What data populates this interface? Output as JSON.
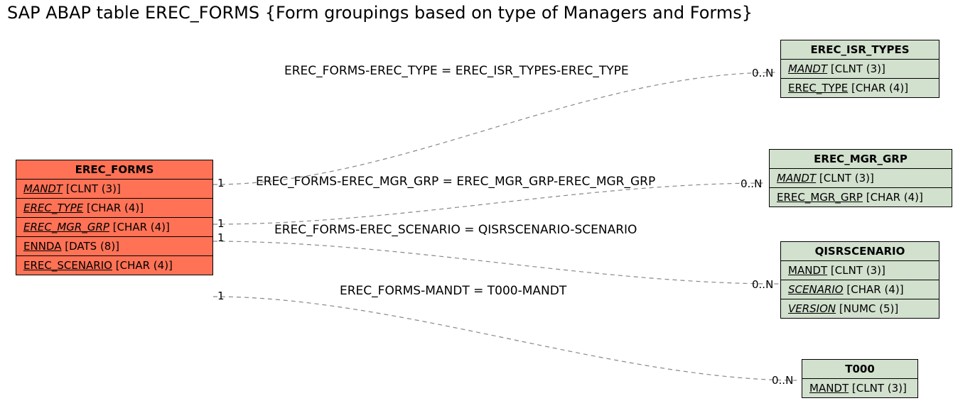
{
  "title": "SAP ABAP table EREC_FORMS {Form groupings based on type of Managers and Forms}",
  "main": {
    "name": "EREC_FORMS",
    "fields": [
      {
        "name": "MANDT",
        "type": "[CLNT (3)]",
        "style": "k"
      },
      {
        "name": "EREC_TYPE",
        "type": "[CHAR (4)]",
        "style": "k"
      },
      {
        "name": "EREC_MGR_GRP",
        "type": "[CHAR (4)]",
        "style": "k"
      },
      {
        "name": "ENNDA",
        "type": "[DATS (8)]",
        "style": "pk"
      },
      {
        "name": "EREC_SCENARIO",
        "type": "[CHAR (4)]",
        "style": "pk"
      }
    ]
  },
  "related": {
    "t1": {
      "name": "EREC_ISR_TYPES",
      "fields": [
        {
          "name": "MANDT",
          "type": "[CLNT (3)]",
          "style": "k"
        },
        {
          "name": "EREC_TYPE",
          "type": "[CHAR (4)]",
          "style": "pk"
        }
      ]
    },
    "t2": {
      "name": "EREC_MGR_GRP",
      "fields": [
        {
          "name": "MANDT",
          "type": "[CLNT (3)]",
          "style": "k"
        },
        {
          "name": "EREC_MGR_GRP",
          "type": "[CHAR (4)]",
          "style": "pk"
        }
      ]
    },
    "t3": {
      "name": "QISRSCENARIO",
      "fields": [
        {
          "name": "MANDT",
          "type": "[CLNT (3)]",
          "style": "pk"
        },
        {
          "name": "SCENARIO",
          "type": "[CHAR (4)]",
          "style": "k"
        },
        {
          "name": "VERSION",
          "type": "[NUMC (5)]",
          "style": "k"
        }
      ]
    },
    "t4": {
      "name": "T000",
      "fields": [
        {
          "name": "MANDT",
          "type": "[CLNT (3)]",
          "style": "pk"
        }
      ]
    }
  },
  "rel_labels": {
    "r1": "EREC_FORMS-EREC_TYPE = EREC_ISR_TYPES-EREC_TYPE",
    "r2": "EREC_FORMS-EREC_MGR_GRP = EREC_MGR_GRP-EREC_MGR_GRP",
    "r3": "EREC_FORMS-EREC_SCENARIO = QISRSCENARIO-SCENARIO",
    "r4": "EREC_FORMS-MANDT = T000-MANDT"
  },
  "card": {
    "left1": "1",
    "left2": "1",
    "left3": "1",
    "left4": "1",
    "right": "0..N"
  }
}
